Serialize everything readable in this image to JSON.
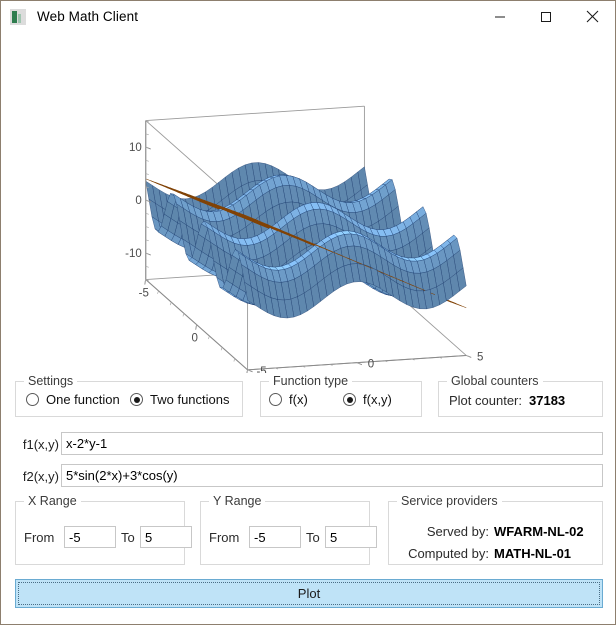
{
  "window": {
    "title": "Web Math Client",
    "icon": "app-icon",
    "controls": {
      "minimize": "minimize-icon",
      "maximize": "maximize-icon",
      "close": "close-icon"
    }
  },
  "settings": {
    "legend": "Settings",
    "options": [
      {
        "label": "One function",
        "checked": false
      },
      {
        "label": "Two functions",
        "checked": true
      }
    ]
  },
  "function_type": {
    "legend": "Function type",
    "options": [
      {
        "label": "f(x)",
        "checked": false
      },
      {
        "label": "f(x,y)",
        "checked": true
      }
    ]
  },
  "global_counters": {
    "legend": "Global counters",
    "plot_counter_label": "Plot counter:",
    "plot_counter_value": "37183"
  },
  "functions": [
    {
      "label": "f1(x,y)",
      "value": "x-2*y-1",
      "placeholder": ""
    },
    {
      "label": "f2(x,y)",
      "value": "5*sin(2*x)+3*cos(y)",
      "placeholder": ""
    }
  ],
  "x_range": {
    "legend": "X Range",
    "from_label": "From",
    "from_value": "-5",
    "to_label": "To",
    "to_value": "5"
  },
  "y_range": {
    "legend": "Y Range",
    "from_label": "From",
    "from_value": "-5",
    "to_label": "To",
    "to_value": "5"
  },
  "service_providers": {
    "legend": "Service providers",
    "served_by_label": "Served by:",
    "served_by_value": "WFARM-NL-02",
    "computed_by_label": "Computed by:",
    "computed_by_value": "MATH-NL-01"
  },
  "plot_button": {
    "label": "Plot"
  },
  "chart_data": {
    "type": "surface",
    "title": "",
    "xlabel": "",
    "ylabel": "",
    "zlabel": "",
    "projection": "3d",
    "xlim": [
      -5,
      5
    ],
    "ylim": [
      -5,
      5
    ],
    "zlim": [
      -15,
      15
    ],
    "x_ticks": [
      -5,
      0,
      5
    ],
    "y_ticks": [
      -5,
      0,
      5
    ],
    "z_ticks": [
      -10,
      0,
      10
    ],
    "grid": true,
    "legend_position": "none",
    "series": [
      {
        "name": "f1(x,y)",
        "expression": "x-2*y-1",
        "color": "#e07b18",
        "edge_color": "#7a3f06",
        "wireframe": true,
        "samples": 21
      },
      {
        "name": "f2(x,y)",
        "expression": "5*sin(2*x)+3*cos(y)",
        "color": "#7fb5e8",
        "edge_color": "#1a3a6b",
        "wireframe": true,
        "samples": 33
      }
    ]
  }
}
